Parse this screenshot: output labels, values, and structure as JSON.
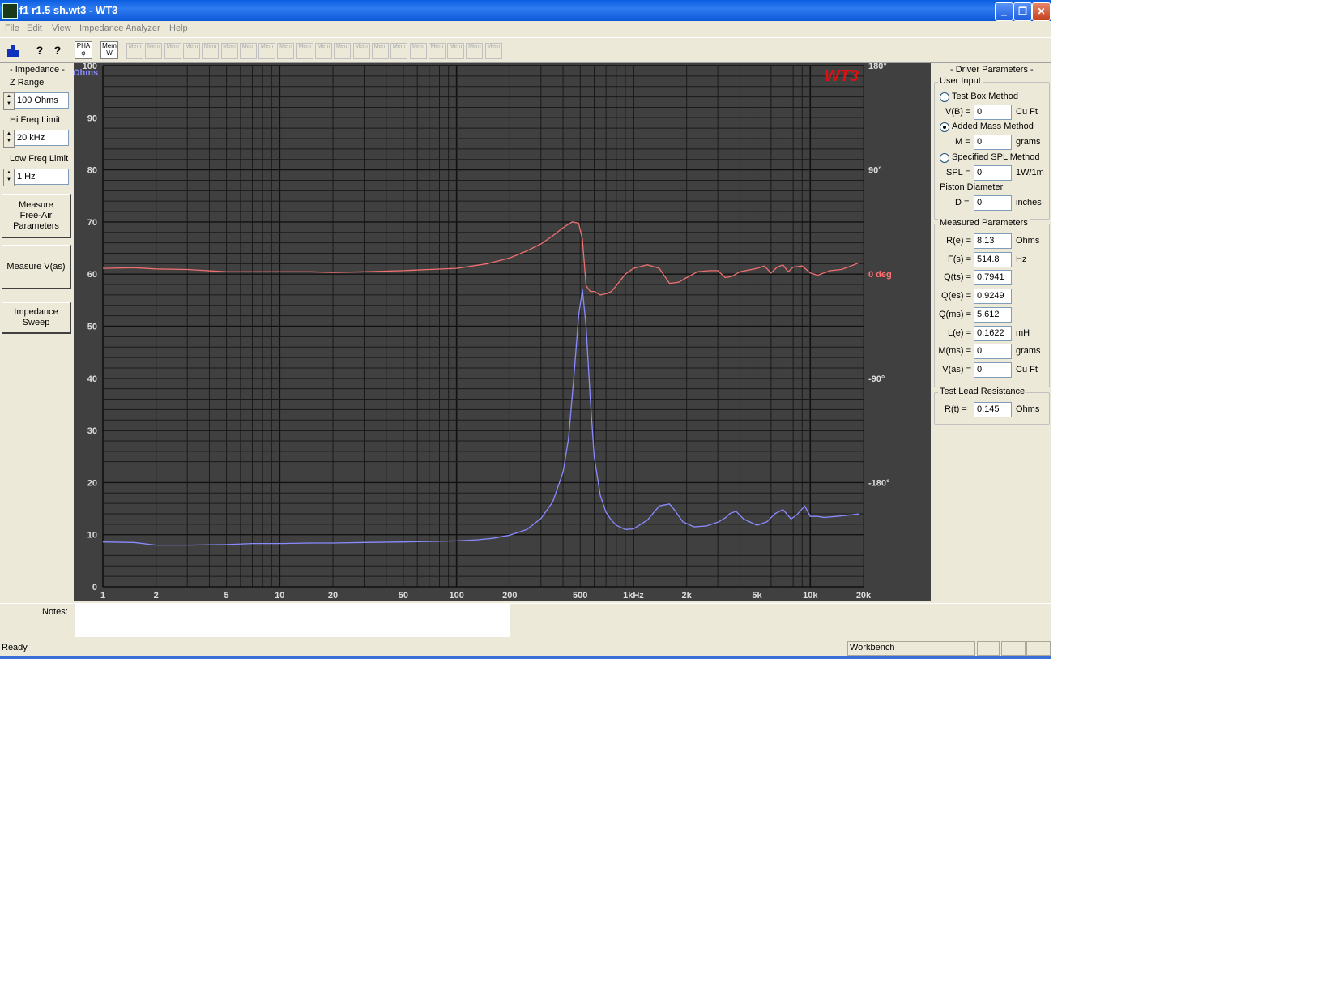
{
  "window": {
    "title": "f1 r1.5 sh.wt3 - WT3",
    "minimize_icon": "minimize-icon",
    "restore_icon": "restore-icon",
    "close_icon": "close-icon"
  },
  "menu": [
    "File",
    "Edit",
    "View",
    "Impedance Analyzer",
    "Help"
  ],
  "toolbar": {
    "pha_label": "PHA",
    "mem_label": "Mem",
    "mem_slots": [
      "Mem",
      "Mem",
      "Mem",
      "Mem",
      "Mem",
      "Mem",
      "Mem",
      "Mem",
      "Mem",
      "Mem",
      "Mem",
      "Mem",
      "Mem",
      "Mem",
      "Mem",
      "Mem",
      "Mem",
      "Mem",
      "Mem",
      "Mem"
    ]
  },
  "left_panel": {
    "title": "- Impedance -",
    "z_range": {
      "label": "Z Range",
      "value": "100 Ohms"
    },
    "hi_freq": {
      "label": "Hi Freq Limit",
      "value": "20 kHz"
    },
    "low_freq": {
      "label": "Low Freq Limit",
      "value": "1 Hz"
    },
    "btn_free_air": "Measure\nFree-Air\nParameters",
    "btn_vas": "Measure V(as)",
    "btn_sweep": "Impedance\nSweep"
  },
  "chart_data": {
    "type": "line",
    "logo": "WT3",
    "xscale": "log",
    "xlim": [
      1,
      20000
    ],
    "x_tick_labels": [
      {
        "x": 1,
        "label": "1"
      },
      {
        "x": 2,
        "label": "2"
      },
      {
        "x": 5,
        "label": "5"
      },
      {
        "x": 10,
        "label": "10"
      },
      {
        "x": 20,
        "label": "20"
      },
      {
        "x": 50,
        "label": "50"
      },
      {
        "x": 100,
        "label": "100"
      },
      {
        "x": 200,
        "label": "200"
      },
      {
        "x": 500,
        "label": "500"
      },
      {
        "x": 1000,
        "label": "1kHz"
      },
      {
        "x": 2000,
        "label": "2k"
      },
      {
        "x": 5000,
        "label": "5k"
      },
      {
        "x": 10000,
        "label": "10k"
      },
      {
        "x": 20000,
        "label": "20k"
      }
    ],
    "y_left": {
      "label": "Ohms",
      "lim": [
        0,
        100
      ],
      "ticks": [
        "0",
        "10",
        "20",
        "30",
        "40",
        "50",
        "60",
        "70",
        "80",
        "90",
        "100"
      ]
    },
    "y_right": {
      "lim": [
        -270,
        180
      ],
      "ticks": [
        {
          "v": 180,
          "label": "180°"
        },
        {
          "v": 90,
          "label": "90°"
        },
        {
          "v": 0,
          "label": "0 deg"
        },
        {
          "v": -90,
          "label": "-90°"
        },
        {
          "v": -180,
          "label": "-180°"
        }
      ]
    },
    "grid": true,
    "colors": {
      "background": "#404040",
      "grid": "#1a1a1a",
      "impedance": "#8a8aff",
      "phase": "#f07070",
      "left_axis_text": "#dddddd",
      "ohms_text": "#8888ff",
      "phase_text": "#ff7070",
      "logo": "#e01010"
    },
    "series": [
      {
        "axis": "left",
        "x": [
          1,
          1.5,
          2,
          3,
          5,
          7,
          10,
          15,
          20,
          30,
          50,
          70,
          100,
          130,
          160,
          200,
          250,
          300,
          350,
          400,
          430,
          460,
          490,
          514.8,
          540,
          570,
          600,
          650,
          700,
          750,
          800,
          900,
          1000,
          1200,
          1400,
          1600,
          1700,
          1900,
          2200,
          2600,
          3000,
          3300,
          3500,
          3800,
          4200,
          5000,
          5700,
          6300,
          7000,
          7800,
          8500,
          9300,
          10000,
          11000,
          12000,
          14000,
          17000,
          19000
        ],
        "y": [
          8.6,
          8.5,
          8.0,
          8.0,
          8.1,
          8.3,
          8.3,
          8.4,
          8.4,
          8.5,
          8.6,
          8.7,
          8.8,
          9.0,
          9.3,
          9.9,
          11.0,
          13.1,
          16.3,
          22.0,
          28.5,
          40.0,
          52.0,
          57.0,
          50.0,
          36.0,
          25.0,
          17.5,
          14.3,
          12.8,
          11.8,
          11.0,
          11.1,
          12.8,
          15.5,
          15.9,
          14.8,
          12.5,
          11.5,
          11.7,
          12.4,
          13.2,
          14.0,
          14.5,
          13.0,
          11.8,
          12.5,
          14.0,
          14.8,
          13.0,
          14.0,
          15.5,
          13.5,
          13.5,
          13.3,
          13.5,
          13.8,
          14.0
        ]
      },
      {
        "axis": "right",
        "x": [
          1,
          1.5,
          2,
          3,
          5,
          7,
          10,
          15,
          20,
          30,
          50,
          70,
          100,
          150,
          200,
          250,
          300,
          350,
          400,
          450,
          490,
          514.8,
          540,
          570,
          600,
          650,
          700,
          750,
          800,
          900,
          1000,
          1200,
          1400,
          1600,
          1800,
          2000,
          2300,
          2700,
          3000,
          3300,
          3600,
          4000,
          5000,
          5500,
          6000,
          6500,
          7000,
          7500,
          8000,
          9000,
          10000,
          11000,
          13000,
          15000,
          17000,
          19000
        ],
        "y": [
          5,
          5.5,
          4.5,
          4,
          2,
          2,
          2,
          2,
          1.5,
          2,
          3,
          4,
          5,
          9,
          14,
          20,
          26,
          33,
          40,
          45,
          44,
          30,
          -10,
          -15,
          -15,
          -18,
          -17,
          -15,
          -10,
          0,
          5,
          8,
          5,
          -8,
          -7,
          -3,
          2,
          3,
          3,
          -3,
          -2,
          2,
          5,
          7,
          1,
          6,
          8,
          2,
          6,
          7,
          1,
          -1,
          3,
          4,
          7,
          10
        ]
      }
    ]
  },
  "right_panel": {
    "title": "- Driver Parameters -",
    "user_input": {
      "legend": "User Input",
      "test_box": "Test Box Method",
      "vb_label": "V(B) =",
      "vb_value": "0",
      "vb_unit": "Cu Ft",
      "added_mass": "Added Mass Method",
      "m_label": "M =",
      "m_value": "0",
      "m_unit": "grams",
      "spl_method": "Specified SPL Method",
      "spl_label": "SPL =",
      "spl_value": "0",
      "spl_unit": "1W/1m",
      "piston": "Piston Diameter",
      "d_label": "D =",
      "d_value": "0",
      "d_unit": "inches"
    },
    "measured": {
      "legend": "Measured Parameters",
      "rows": [
        {
          "label": "R(e) =",
          "value": "8.13",
          "unit": "Ohms"
        },
        {
          "label": "F(s) =",
          "value": "514.8",
          "unit": "Hz"
        },
        {
          "label": "Q(ts) =",
          "value": "0.7941",
          "unit": ""
        },
        {
          "label": "Q(es) =",
          "value": "0.9249",
          "unit": ""
        },
        {
          "label": "Q(ms) =",
          "value": "5.612",
          "unit": ""
        },
        {
          "label": "L(e) =",
          "value": "0.1622",
          "unit": "mH"
        },
        {
          "label": "M(ms) =",
          "value": "0",
          "unit": "grams"
        },
        {
          "label": "V(as) =",
          "value": "0",
          "unit": "Cu Ft"
        }
      ]
    },
    "lead": {
      "legend": "Test Lead Resistance",
      "label": "R(t) =",
      "value": "0.145",
      "unit": "Ohms"
    }
  },
  "notes": {
    "label": "Notes:",
    "value": ""
  },
  "status": {
    "text": "Ready",
    "pane": "Workbench"
  }
}
